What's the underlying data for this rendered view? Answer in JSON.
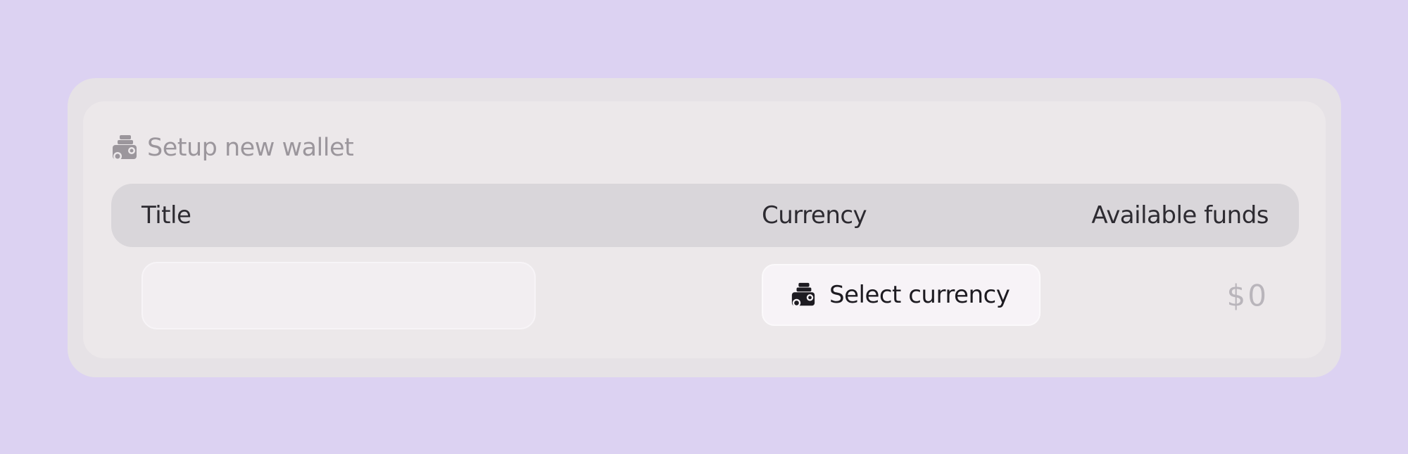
{
  "app": {
    "header_title": "Setup new wallet",
    "header_icon": "wallet-coins-icon"
  },
  "table": {
    "columns": {
      "title": "Title",
      "currency": "Currency",
      "funds": "Available funds"
    },
    "row": {
      "title_value": "",
      "title_placeholder": "",
      "currency_button_label": "Select currency",
      "currency_button_icon": "wallet-coins-icon",
      "funds_value": "$0"
    }
  },
  "colors": {
    "background": "#dcd2f2",
    "card": "#e6e2e6",
    "table_header": "#d9d6da",
    "muted_text": "#9b969c",
    "dark_text": "#1d1b21"
  }
}
